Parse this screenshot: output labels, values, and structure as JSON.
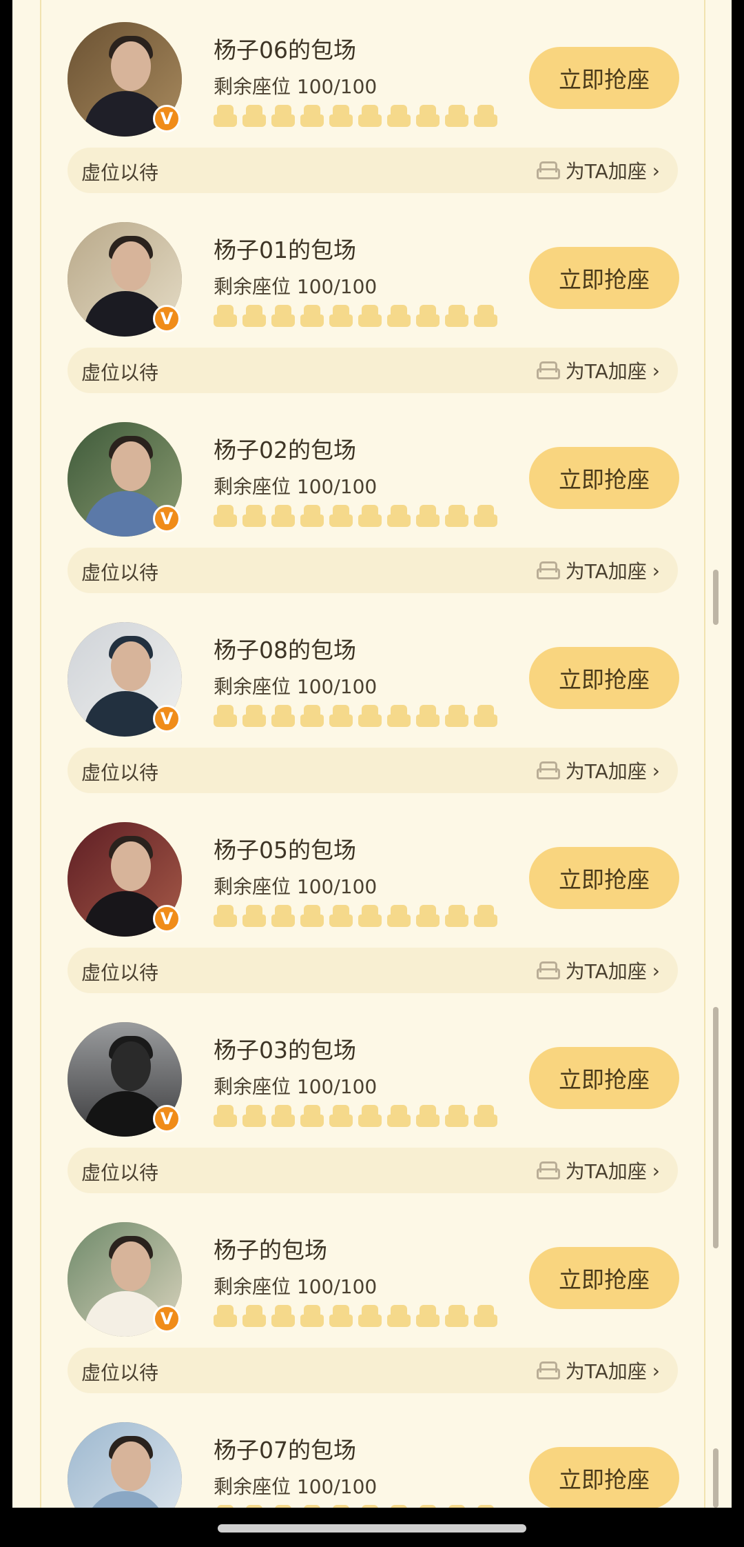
{
  "rows": [
    {
      "title": "杨子06的包场",
      "seats": "剩余座位 100/100",
      "button": "立即抢座",
      "waiting": "虚位以待",
      "add": "为TA加座",
      "chevron": "›",
      "badge": "V"
    },
    {
      "title": "杨子01的包场",
      "seats": "剩余座位 100/100",
      "button": "立即抢座",
      "waiting": "虚位以待",
      "add": "为TA加座",
      "chevron": "›",
      "badge": "V"
    },
    {
      "title": "杨子02的包场",
      "seats": "剩余座位 100/100",
      "button": "立即抢座",
      "waiting": "虚位以待",
      "add": "为TA加座",
      "chevron": "›",
      "badge": "V"
    },
    {
      "title": "杨子08的包场",
      "seats": "剩余座位 100/100",
      "button": "立即抢座",
      "waiting": "虚位以待",
      "add": "为TA加座",
      "chevron": "›",
      "badge": "V"
    },
    {
      "title": "杨子05的包场",
      "seats": "剩余座位 100/100",
      "button": "立即抢座",
      "waiting": "虚位以待",
      "add": "为TA加座",
      "chevron": "›",
      "badge": "V"
    },
    {
      "title": "杨子03的包场",
      "seats": "剩余座位 100/100",
      "button": "立即抢座",
      "waiting": "虚位以待",
      "add": "为TA加座",
      "chevron": "›",
      "badge": "V"
    },
    {
      "title": "杨子的包场",
      "seats": "剩余座位 100/100",
      "button": "立即抢座",
      "waiting": "虚位以待",
      "add": "为TA加座",
      "chevron": "›",
      "badge": "V"
    },
    {
      "title": "杨子07的包场",
      "seats": "剩余座位 100/100",
      "button": "立即抢座",
      "waiting": "",
      "add": "",
      "chevron": "",
      "badge": ""
    }
  ],
  "seat_icons_per_row": 10,
  "colors": {
    "background": "#fdf8e6",
    "button": "#f9d57f",
    "seat": "#f5d98b",
    "badge": "#f08c1a",
    "bar": "#f8efd2"
  }
}
